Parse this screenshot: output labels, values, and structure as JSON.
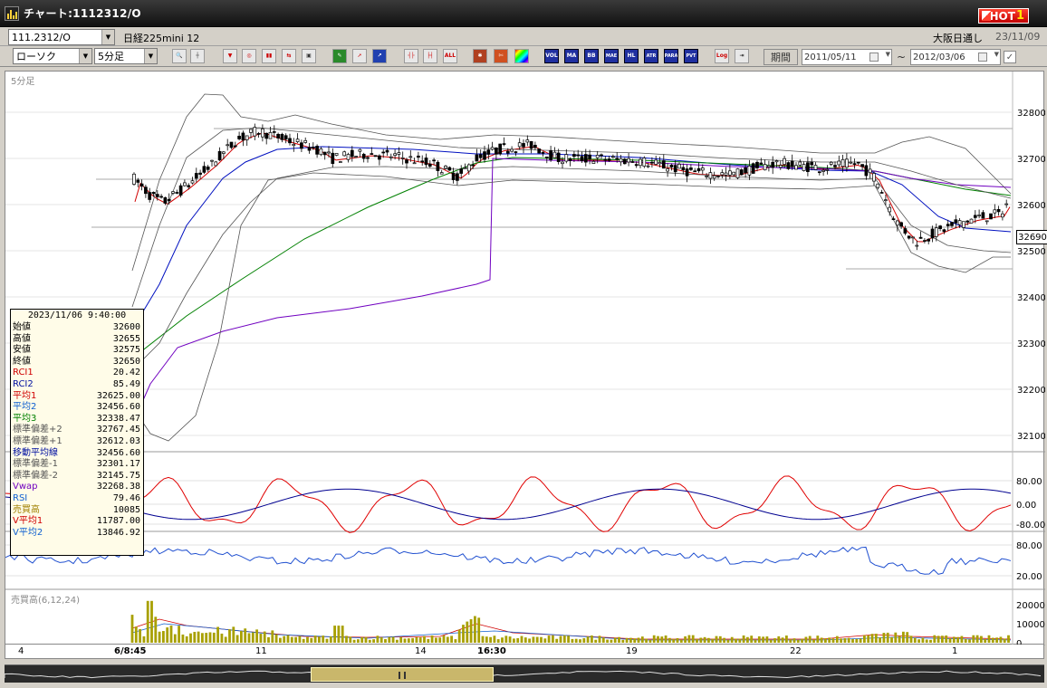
{
  "window": {
    "title": "チャート:1112312/O",
    "hot_label": "HOT",
    "hot_number": "1"
  },
  "toolbar1": {
    "symbol_code": "111.2312/O",
    "symbol_name": "日経225mini 12",
    "market": "大阪日通し",
    "date": "23/11/09"
  },
  "toolbar2": {
    "chart_type": "ローソク",
    "interval": "5分足",
    "period_label": "期間",
    "date_from": "2011/05/11",
    "date_to": "2012/03/06",
    "tilde": "~",
    "buttons": [
      "VOL",
      "MA",
      "BB",
      "MAE",
      "HL",
      "ATR",
      "PARA",
      "PVT",
      "Log"
    ]
  },
  "chart": {
    "interval_label": "5分足",
    "volume_label": "売買高(6,12,24)",
    "current_price": "32690",
    "price_axis": [
      "32800",
      "32700",
      "32600",
      "32500",
      "32400",
      "32300",
      "32200",
      "32100"
    ],
    "osc_axis": [
      "80.00",
      "0.00",
      "-80.00"
    ],
    "rsi_axis": [
      "80.00",
      "20.00"
    ],
    "vol_axis": [
      "20000",
      "10000",
      "0"
    ],
    "x_labels": [
      "4",
      "6/8:45",
      "11",
      "14",
      "16:30",
      "19",
      "22",
      "1"
    ],
    "x_bold": [
      false,
      true,
      false,
      false,
      true,
      false,
      false,
      false
    ],
    "colors": {
      "candle": "#000",
      "ma1": "#d00000",
      "ma2": "#0010c0",
      "ma3": "#008000",
      "vwap": "#7000c0",
      "band": "#000",
      "rci1": "#e00000",
      "rci2": "#000090",
      "rsi": "#2050d0",
      "volume": "#a8a000"
    }
  },
  "info": {
    "timestamp": "2023/11/06 9:40:00",
    "rows": [
      {
        "label": "始値",
        "value": "32600",
        "color": "#000"
      },
      {
        "label": "高値",
        "value": "32655",
        "color": "#000"
      },
      {
        "label": "安値",
        "value": "32575",
        "color": "#000"
      },
      {
        "label": "終値",
        "value": "32650",
        "color": "#000"
      },
      {
        "label": "RCI1",
        "value": "20.42",
        "color": "#d00000"
      },
      {
        "label": "RCI2",
        "value": "85.49",
        "color": "#0010a0"
      },
      {
        "label": "平均1",
        "value": "32625.00",
        "color": "#d00000"
      },
      {
        "label": "平均2",
        "value": "32456.60",
        "color": "#1060d0"
      },
      {
        "label": "平均3",
        "value": "32338.47",
        "color": "#008000"
      },
      {
        "label": "標準偏差+2",
        "value": "32767.45",
        "color": "#555"
      },
      {
        "label": "標準偏差+1",
        "value": "32612.03",
        "color": "#555"
      },
      {
        "label": "移動平均線",
        "value": "32456.60",
        "color": "#0010a0"
      },
      {
        "label": "標準偏差-1",
        "value": "32301.17",
        "color": "#555"
      },
      {
        "label": "標準偏差-2",
        "value": "32145.75",
        "color": "#555"
      },
      {
        "label": "Vwap",
        "value": "32268.38",
        "color": "#7000c0"
      },
      {
        "label": "RSI",
        "value": "79.46",
        "color": "#1060d0"
      },
      {
        "label": "売買高",
        "value": "10085",
        "color": "#a08000"
      },
      {
        "label": "V平均1",
        "value": "11787.00",
        "color": "#d00000"
      },
      {
        "label": "V平均2",
        "value": "13846.92",
        "color": "#1060d0"
      }
    ]
  }
}
